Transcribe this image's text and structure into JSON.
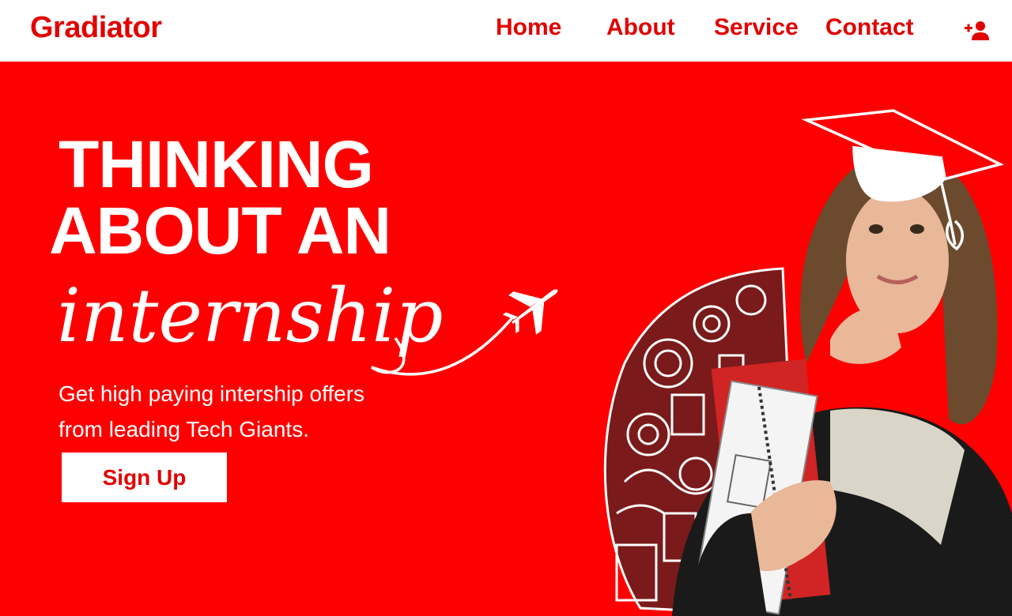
{
  "brand": {
    "logo_text": "Gradiator",
    "accent_color": "#e10000",
    "hero_bg": "#ff0000"
  },
  "nav": {
    "items": [
      {
        "label": "Home"
      },
      {
        "label": "About"
      },
      {
        "label": "Service"
      },
      {
        "label": "Contact"
      }
    ],
    "user_action_icon": "add-user-icon"
  },
  "hero": {
    "headline_line1": "THINKING",
    "headline_line2": "ABOUT AN",
    "script_word": "internship",
    "subtitle_line1": "Get high paying intership offers",
    "subtitle_line2": "from leading Tech Giants.",
    "cta_label": "Sign Up",
    "decor_icons": [
      "airplane-icon",
      "graduation-cap-icon",
      "student-photo",
      "doodle-art"
    ]
  }
}
